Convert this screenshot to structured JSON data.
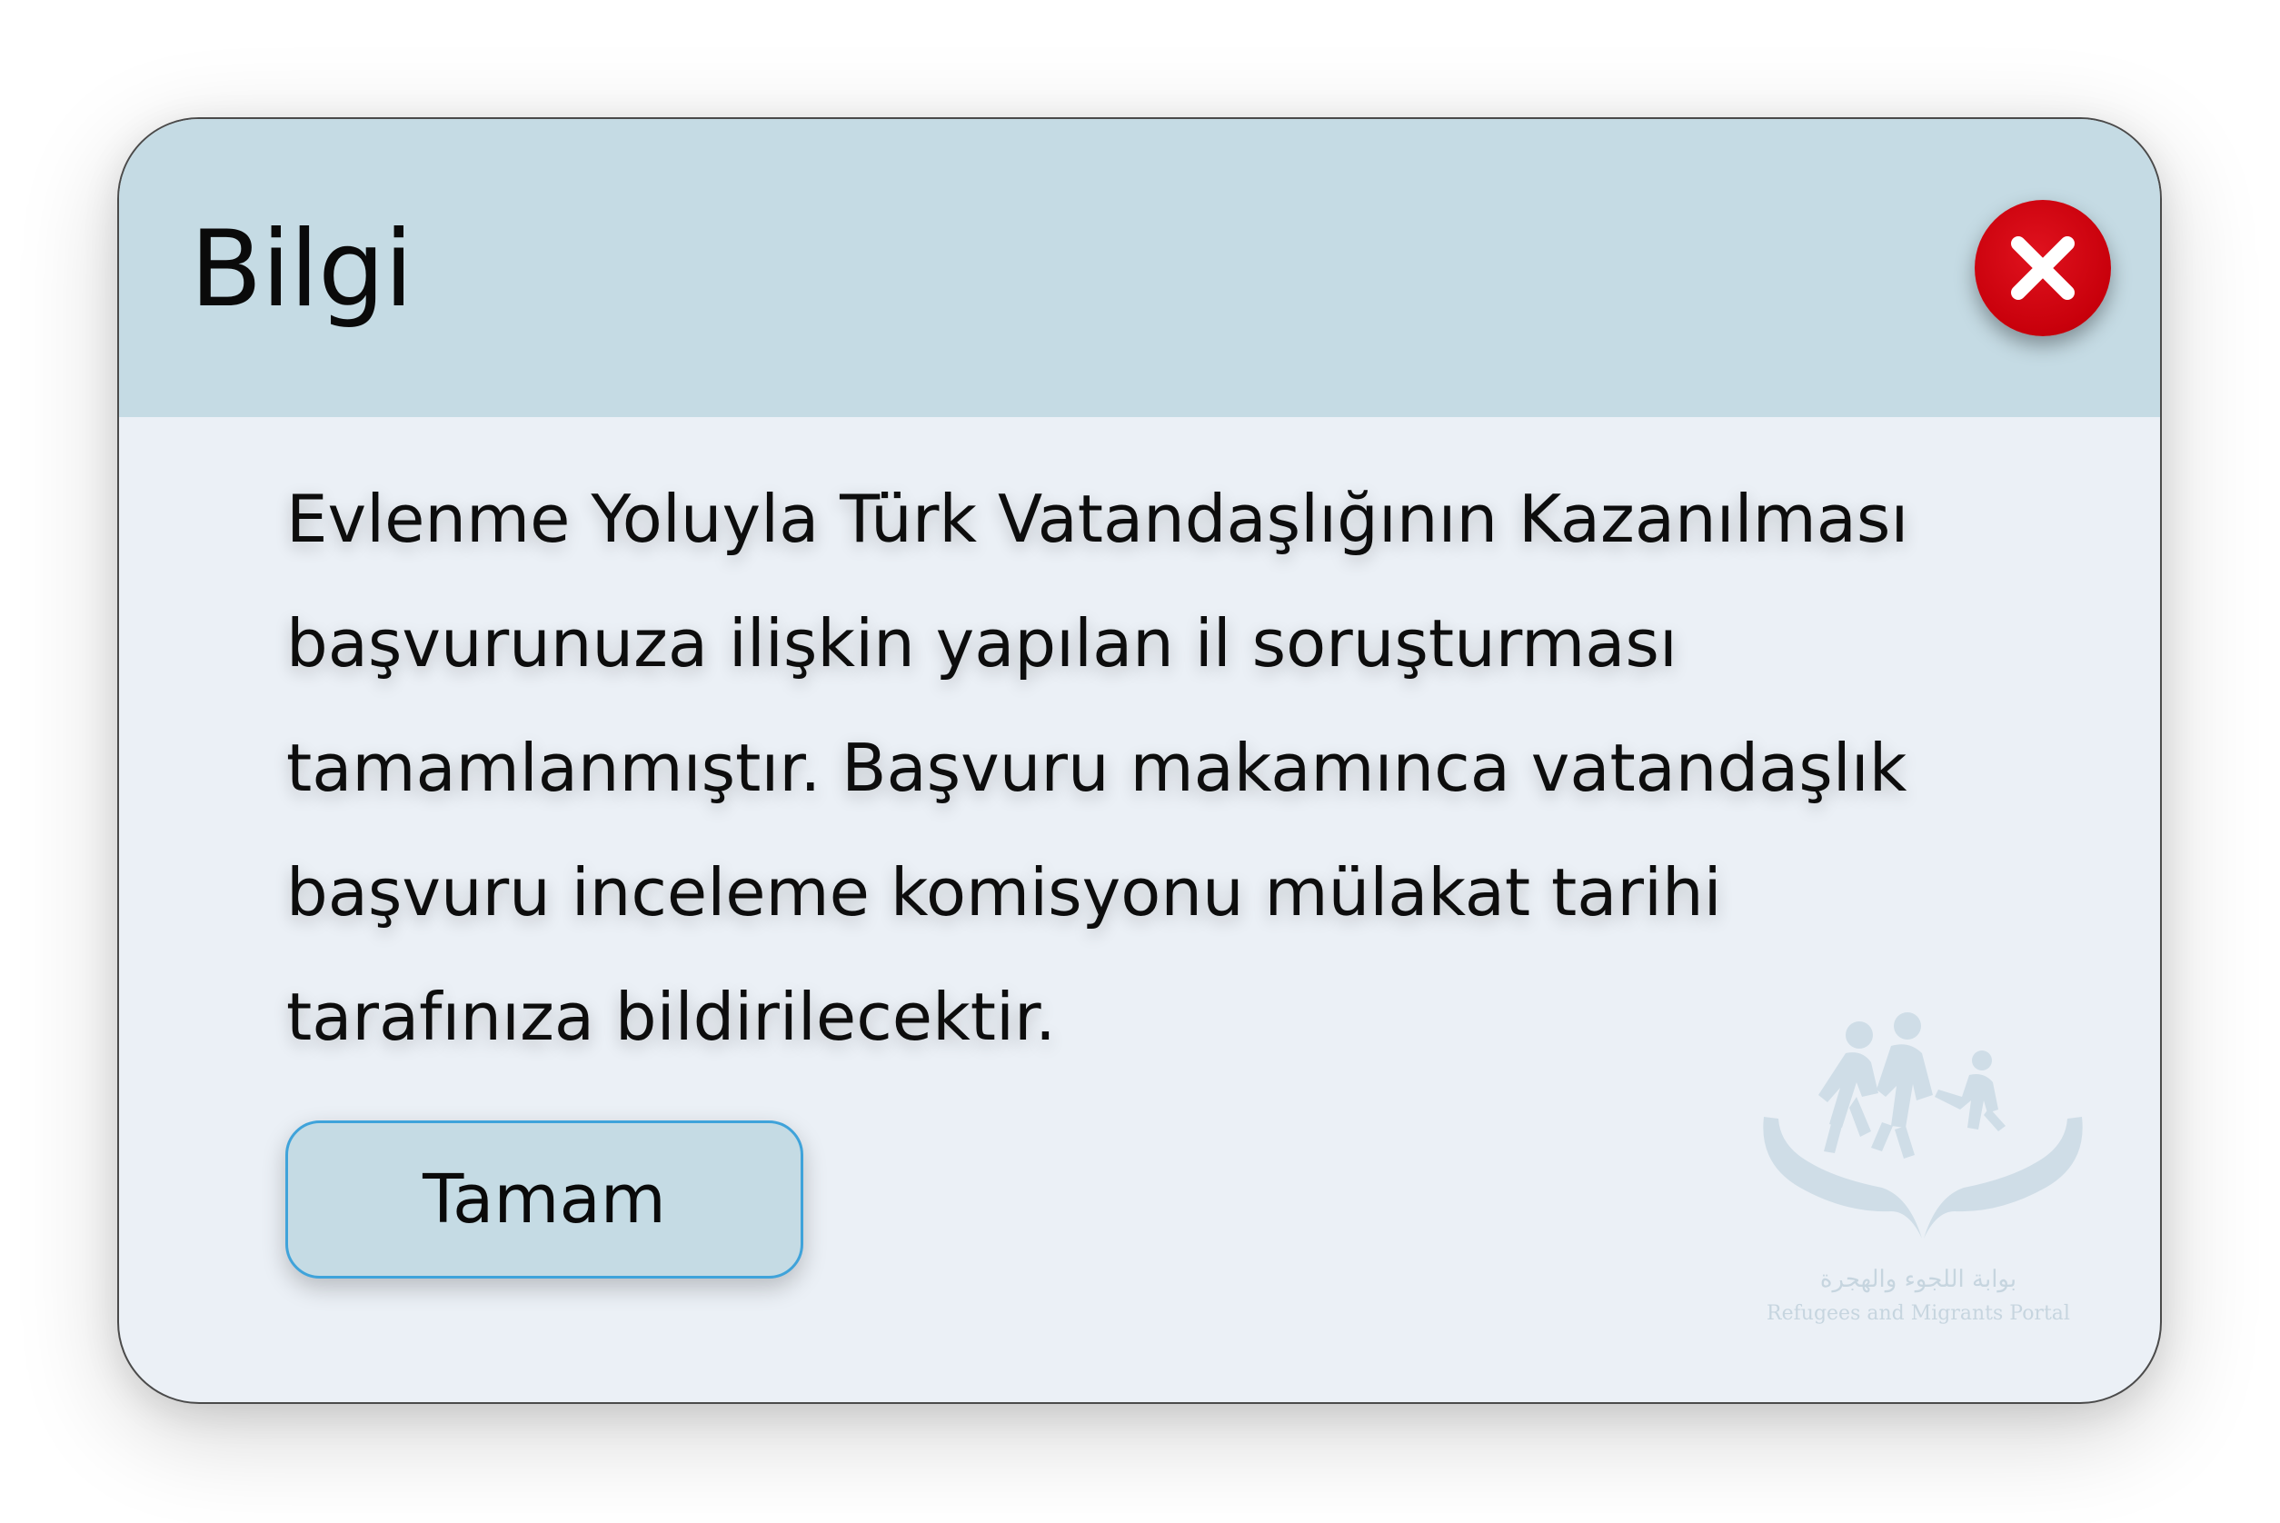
{
  "dialog": {
    "title": "Bilgi",
    "message": "Evlenme Yoluyla Türk Vatandaşlığının Kazanılması başvurunuza ilişkin yapılan il soruşturması tamamlanmıştır. Başvuru makamınca vatandaşlık başvuru inceleme komisyonu mülakat tarihi tarafınıza bildirilecektir.",
    "ok_label": "Tamam",
    "close_icon": "close-x-icon"
  },
  "watermark": {
    "arabic_text": "بوابة اللجوء والهجرة",
    "english_text": "Refugees and Migrants Portal",
    "icon": "family-hands-logo"
  },
  "colors": {
    "header_bg": "#c5dbe4",
    "body_bg": "#ebf0f6",
    "close_red": "#c8000b",
    "button_border": "#3fa3da"
  }
}
